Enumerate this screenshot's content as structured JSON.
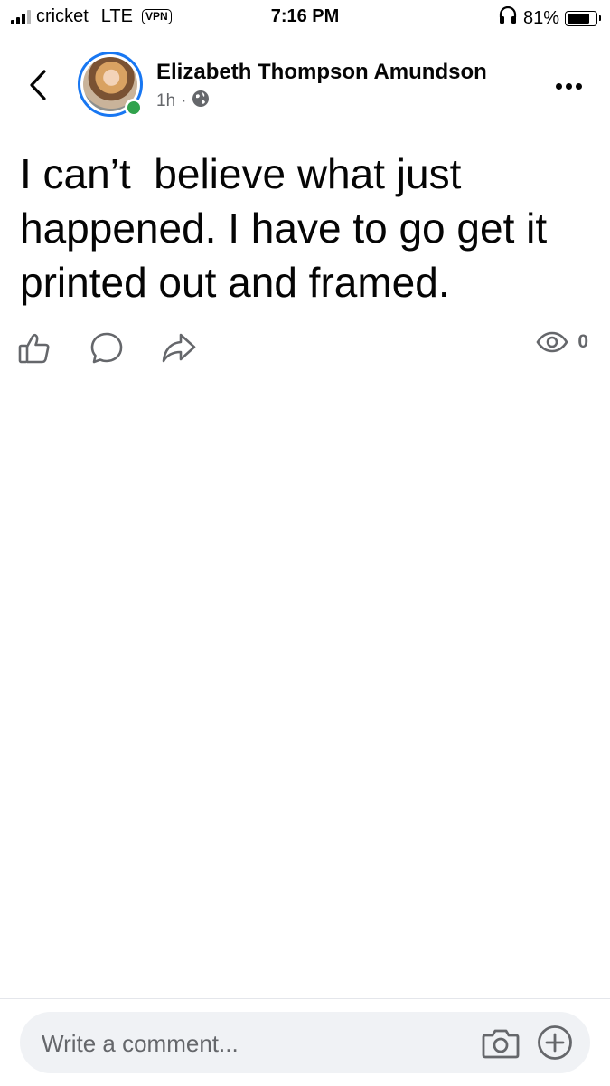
{
  "status_bar": {
    "carrier": "cricket",
    "network": "LTE",
    "vpn": "VPN",
    "time": "7:16 PM",
    "battery_text": "81%",
    "battery_level": 0.81,
    "icons": [
      "signal-icon",
      "headphones-icon",
      "battery-icon"
    ]
  },
  "header": {
    "back_icon": "chevron-left-icon",
    "author_name": "Elizabeth Thompson Amundson",
    "time_ago": "1h",
    "separator": "·",
    "privacy_icon": "globe-icon",
    "online": true,
    "online_color": "#31a24c",
    "ring_color": "#1877f2",
    "more_icon": "more-horizontal-icon"
  },
  "post": {
    "text": "I can’t  believe what just happened. I have to go get it printed out and framed."
  },
  "actions": {
    "like_icon": "thumbs-up-icon",
    "comment_icon": "comment-icon",
    "share_icon": "share-icon",
    "views_icon": "eye-icon",
    "views_count": "0"
  },
  "comment_bar": {
    "placeholder": "Write a comment...",
    "value": "",
    "camera_icon": "camera-icon",
    "add_icon": "plus-circle-icon"
  }
}
